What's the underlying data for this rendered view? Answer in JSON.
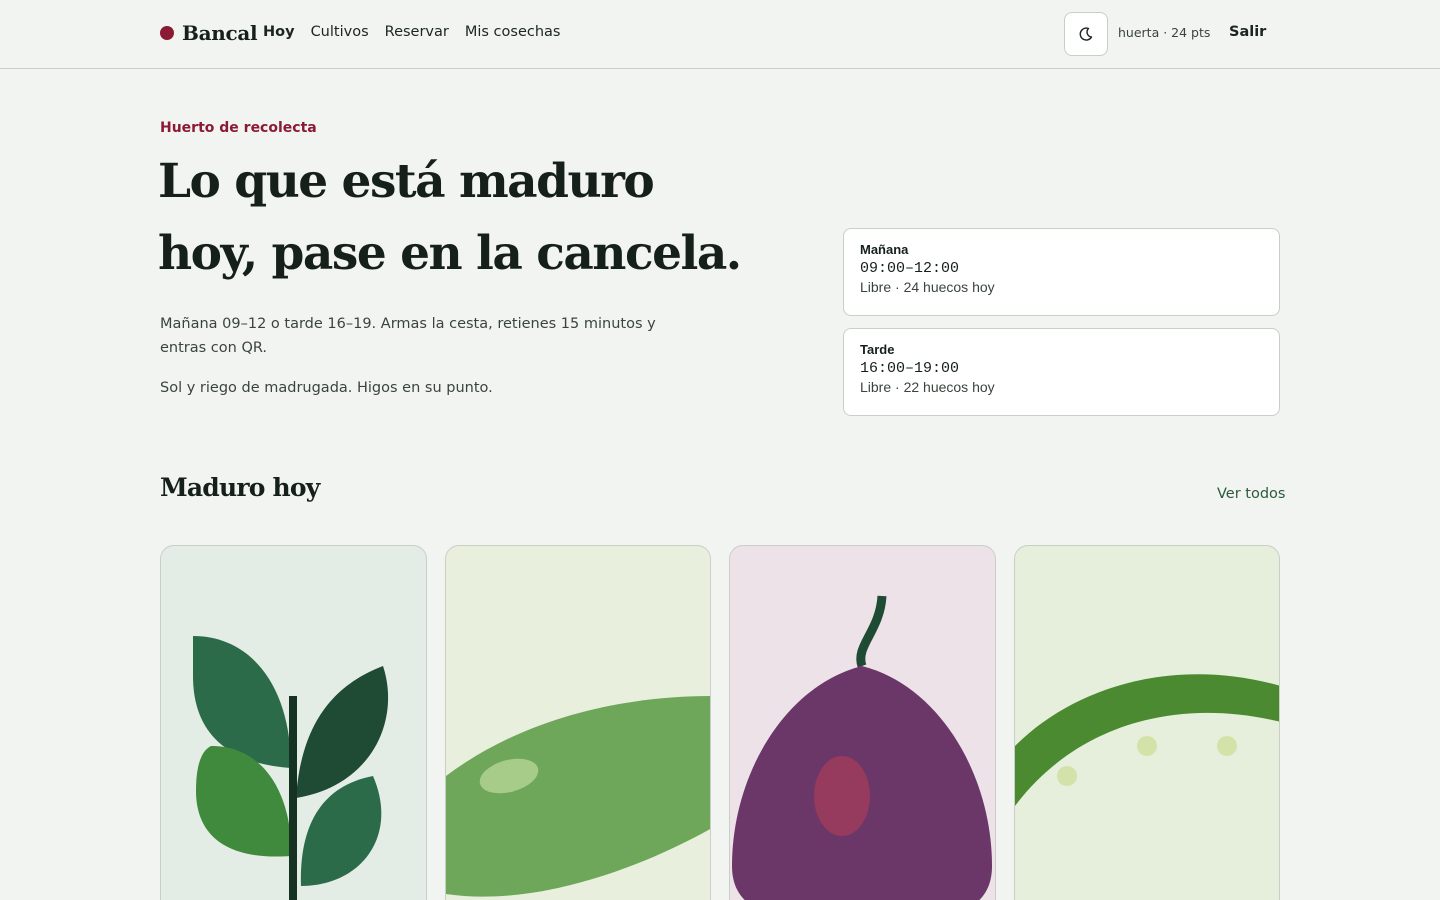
{
  "brand": {
    "name": "Bancal",
    "accent": "#8b1a35"
  },
  "nav": {
    "items": [
      {
        "label": "Hoy",
        "active": true
      },
      {
        "label": "Cultivos",
        "active": false
      },
      {
        "label": "Reservar",
        "active": false
      },
      {
        "label": "Mis cosechas",
        "active": false
      }
    ]
  },
  "header": {
    "theme_icon": "moon-icon",
    "user_points": "huerta · 24 pts",
    "logout_label": "Salir"
  },
  "hero": {
    "eyebrow": "Huerto de recolecta",
    "title_line1": "Lo que está maduro",
    "title_line2": "hoy, pase en la cancela.",
    "description": "Mañana 09–12 o tarde 16–19. Armas la cesta, retienes 15 minutos y entras con QR.",
    "note": "Sol y riego de madrugada. Higos en su punto."
  },
  "slots": [
    {
      "name": "Mañana",
      "time": "09:00–12:00",
      "status": "Libre · 24 huecos hoy"
    },
    {
      "name": "Tarde",
      "time": "16:00–19:00",
      "status": "Libre · 22 huecos hoy"
    }
  ],
  "section": {
    "title": "Maduro hoy",
    "see_all": "Ver todos"
  },
  "produce": [
    {
      "icon": "herb-leaves-icon",
      "background": "#e3ece5"
    },
    {
      "icon": "pepper-icon",
      "background": "#e8efdc"
    },
    {
      "icon": "fig-icon",
      "background": "#ece2e7"
    },
    {
      "icon": "pea-pod-icon",
      "background": "#e6efdc"
    }
  ]
}
